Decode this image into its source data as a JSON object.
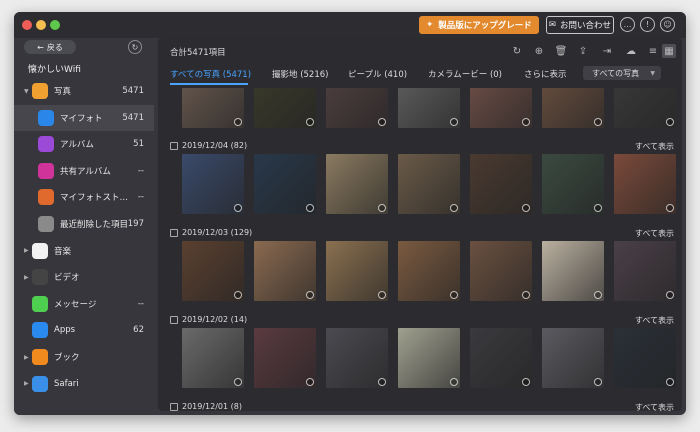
{
  "titlebar": {
    "upgrade_label": "製品版にアップグレード",
    "contact_label": "お問い合わせ"
  },
  "sidebar": {
    "back_label": "戻る",
    "device_name": "懐かしいWifi",
    "items": [
      {
        "label": "写真",
        "count": "5471",
        "icon": "photos-icon",
        "color": "#f0a030",
        "level": 0,
        "expand": true,
        "expanded": true
      },
      {
        "label": "マイフォト",
        "count": "5471",
        "icon": "my-photo-icon",
        "color": "#2a86e8",
        "level": 1,
        "active": true
      },
      {
        "label": "アルバム",
        "count": "51",
        "icon": "album-icon",
        "color": "#9b4ad8",
        "level": 1
      },
      {
        "label": "共有アルバム",
        "count": "--",
        "icon": "shared-album-icon",
        "color": "#d0349a",
        "level": 1
      },
      {
        "label": "マイフォトスト…",
        "count": "--",
        "icon": "photo-stream-icon",
        "color": "#e0692e",
        "level": 1
      },
      {
        "label": "最近削除した項目",
        "count": "197",
        "icon": "trash-icon",
        "color": "#8a8a8a",
        "level": 1
      },
      {
        "label": "音楽",
        "count": "",
        "icon": "music-icon",
        "color": "#f2f2f2",
        "level": 0,
        "expand": true
      },
      {
        "label": "ビデオ",
        "count": "",
        "icon": "video-icon",
        "color": "#444",
        "level": 0,
        "expand": true
      },
      {
        "label": "メッセージ",
        "count": "--",
        "icon": "message-icon",
        "color": "#4fcf4f",
        "level": 0
      },
      {
        "label": "Apps",
        "count": "62",
        "icon": "apps-icon",
        "color": "#2b8af0",
        "level": 0
      },
      {
        "label": "ブック",
        "count": "",
        "icon": "book-icon",
        "color": "#f08a1e",
        "level": 0,
        "expand": true
      },
      {
        "label": "Safari",
        "count": "",
        "icon": "safari-icon",
        "color": "#3a90e8",
        "level": 0,
        "expand": true
      }
    ]
  },
  "main": {
    "total_label": "合計5471項目",
    "tabs": [
      {
        "label": "すべての写真 (5471)",
        "active": true
      },
      {
        "label": "撮影地 (5216)"
      },
      {
        "label": "ピープル (410)"
      },
      {
        "label": "カメラムービー (0)"
      },
      {
        "label": "さらに表示"
      }
    ],
    "filter_value": "すべての写真",
    "show_all": "すべて表示",
    "groups": [
      {
        "date": "2019/12/04 (82)",
        "colors": [
          "#3a4a6a",
          "#28384a",
          "#8a7a60",
          "#6a5a48",
          "#4a3a30",
          "#3a4a40",
          "#7a4a3a"
        ]
      },
      {
        "date": "2019/12/03 (129)",
        "colors": [
          "#5a4030",
          "#8a6a50",
          "#8a7050",
          "#7a5a40",
          "#6a5040",
          "#bab0a0",
          "#4a4048"
        ]
      },
      {
        "date": "2019/12/02 (14)",
        "colors": [
          "#6a6a6a",
          "#5a3a40",
          "#4a4a50",
          "#a0a090",
          "#3a3a3e",
          "#5a5a60",
          "#2a3038"
        ]
      },
      {
        "date": "2019/12/01 (8)",
        "colors": []
      }
    ],
    "top_row_colors": [
      "#6a5a50",
      "#3a3a2a",
      "#504040",
      "#606060",
      "#705048",
      "#6a5040",
      "#3a3a3a"
    ]
  },
  "colors": {
    "accent": "#4aa3ff",
    "upgrade": "#e48a2e"
  }
}
